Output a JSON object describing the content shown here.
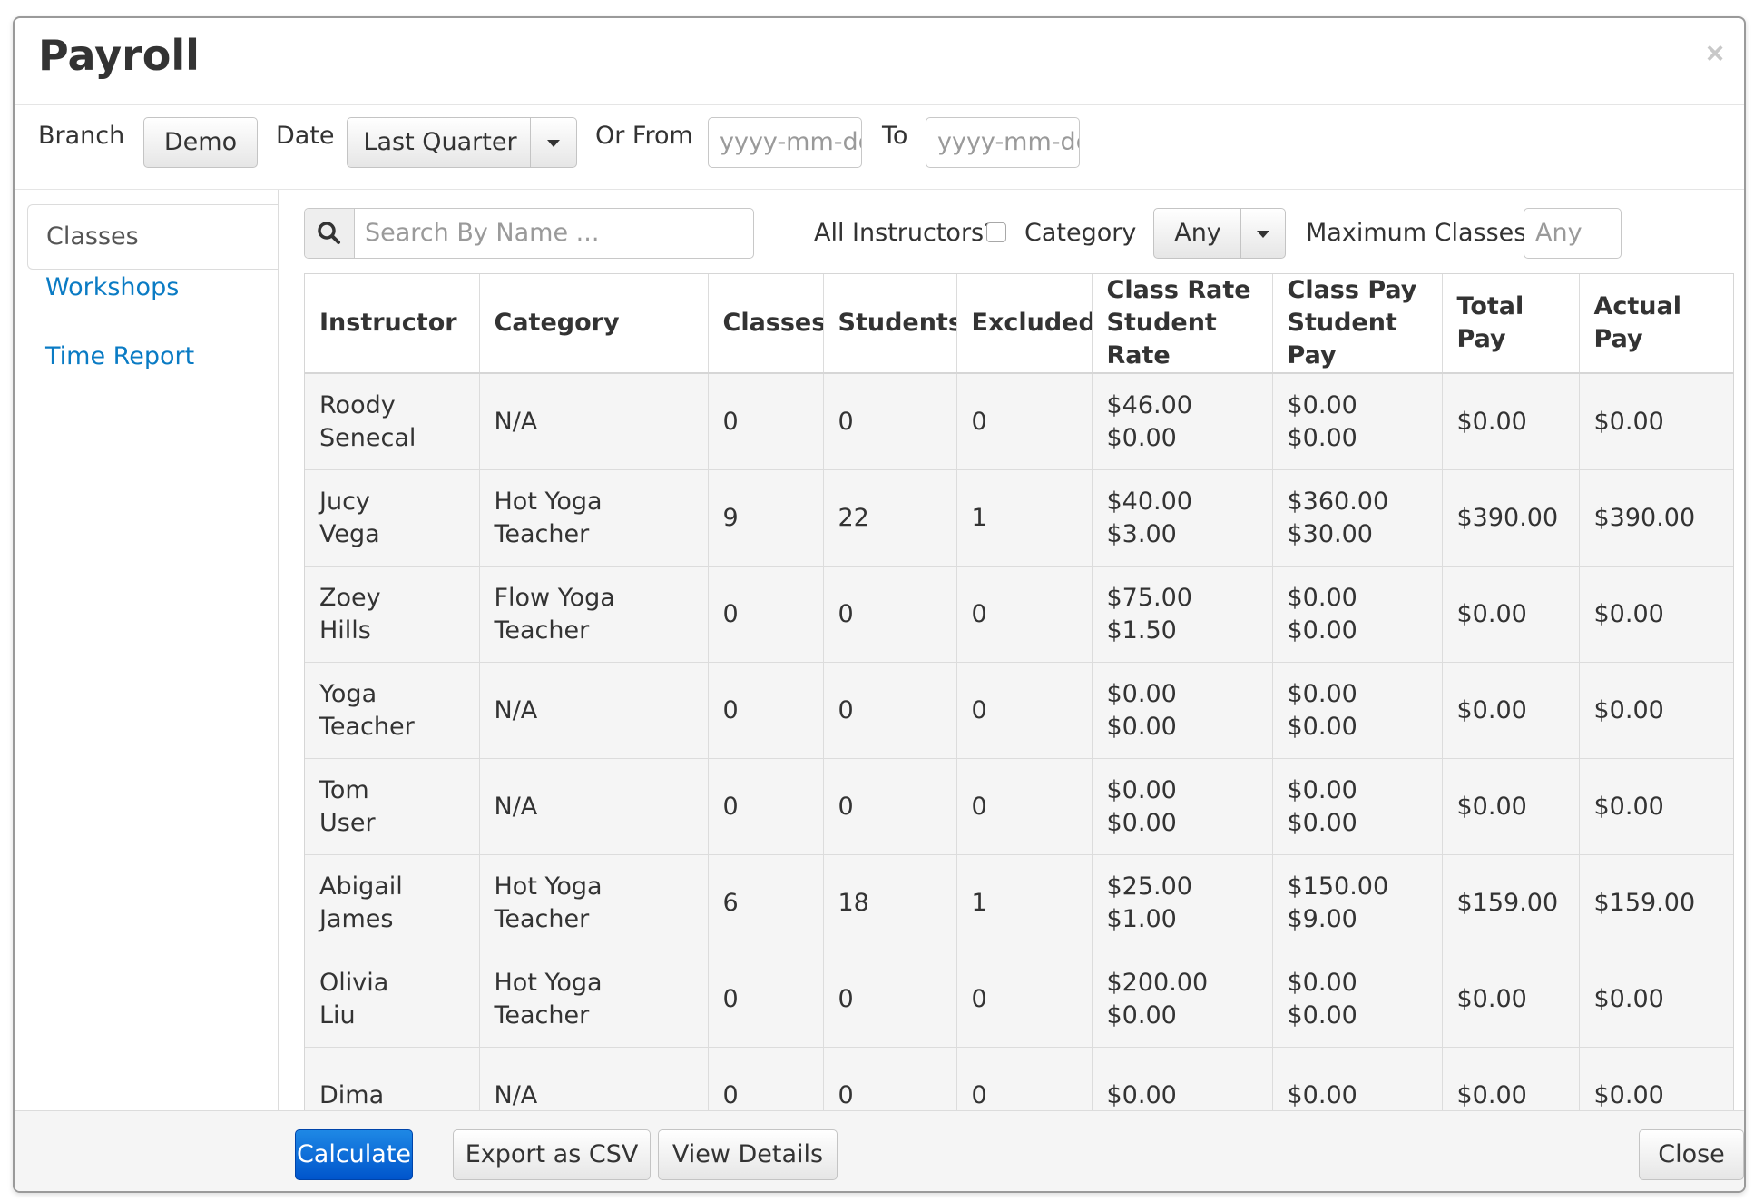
{
  "modal": {
    "title": "Payroll",
    "close_symbol": "×"
  },
  "filters": {
    "branch_label": "Branch",
    "branch_value": "Demo",
    "date_label": "Date",
    "date_value": "Last Quarter",
    "or_from_label": "Or From",
    "from_placeholder": "yyyy-mm-dd",
    "to_label": "To",
    "to_placeholder": "yyyy-mm-dd"
  },
  "sidebar": {
    "tabs": [
      {
        "label": "Classes",
        "active": true
      },
      {
        "label": "Workshops",
        "active": false
      },
      {
        "label": "Time Report",
        "active": false
      }
    ]
  },
  "toolbar": {
    "search_placeholder": "Search By Name ...",
    "search_icon": "search-icon",
    "all_instructors_label": "All Instructors?",
    "all_instructors_checked": false,
    "category_label": "Category",
    "category_value": "Any",
    "max_classes_label": "Maximum Classes",
    "max_classes_placeholder": "Any"
  },
  "table": {
    "headers": [
      {
        "line1": "Instructor",
        "line2": ""
      },
      {
        "line1": "Category",
        "line2": ""
      },
      {
        "line1": "Classes",
        "line2": ""
      },
      {
        "line1": "Students",
        "line2": ""
      },
      {
        "line1": "Excluded",
        "line2": ""
      },
      {
        "line1": "Class Rate",
        "line2": "Student Rate"
      },
      {
        "line1": "Class Pay",
        "line2": "Student Pay"
      },
      {
        "line1": "Total Pay",
        "line2": ""
      },
      {
        "line1": "Actual Pay",
        "line2": ""
      }
    ],
    "rows": [
      {
        "first": "Roody",
        "last": "Senecal",
        "category": "N/A",
        "classes": "0",
        "students": "0",
        "excluded": "0",
        "class_rate": "$46.00",
        "student_rate": "$0.00",
        "class_pay": "$0.00",
        "student_pay": "$0.00",
        "total_pay": "$0.00",
        "actual_pay": "$0.00"
      },
      {
        "first": "Jucy",
        "last": "Vega",
        "category": "Hot Yoga Teacher",
        "classes": "9",
        "students": "22",
        "excluded": "1",
        "class_rate": "$40.00",
        "student_rate": "$3.00",
        "class_pay": "$360.00",
        "student_pay": "$30.00",
        "total_pay": "$390.00",
        "actual_pay": "$390.00"
      },
      {
        "first": "Zoey",
        "last": "Hills",
        "category": "Flow Yoga Teacher",
        "classes": "0",
        "students": "0",
        "excluded": "0",
        "class_rate": "$75.00",
        "student_rate": "$1.50",
        "class_pay": "$0.00",
        "student_pay": "$0.00",
        "total_pay": "$0.00",
        "actual_pay": "$0.00"
      },
      {
        "first": "Yoga",
        "last": "Teacher",
        "category": "N/A",
        "classes": "0",
        "students": "0",
        "excluded": "0",
        "class_rate": "$0.00",
        "student_rate": "$0.00",
        "class_pay": "$0.00",
        "student_pay": "$0.00",
        "total_pay": "$0.00",
        "actual_pay": "$0.00"
      },
      {
        "first": "Tom",
        "last": "User",
        "category": "N/A",
        "classes": "0",
        "students": "0",
        "excluded": "0",
        "class_rate": "$0.00",
        "student_rate": "$0.00",
        "class_pay": "$0.00",
        "student_pay": "$0.00",
        "total_pay": "$0.00",
        "actual_pay": "$0.00"
      },
      {
        "first": "Abigail",
        "last": "James",
        "category": "Hot Yoga Teacher",
        "classes": "6",
        "students": "18",
        "excluded": "1",
        "class_rate": "$25.00",
        "student_rate": "$1.00",
        "class_pay": "$150.00",
        "student_pay": "$9.00",
        "total_pay": "$159.00",
        "actual_pay": "$159.00"
      },
      {
        "first": "Olivia",
        "last": "Liu",
        "category": "Hot Yoga Teacher",
        "classes": "0",
        "students": "0",
        "excluded": "0",
        "class_rate": "$200.00",
        "student_rate": "$0.00",
        "class_pay": "$0.00",
        "student_pay": "$0.00",
        "total_pay": "$0.00",
        "actual_pay": "$0.00"
      },
      {
        "first": "Dima",
        "last": "",
        "category": "N/A",
        "classes": "0",
        "students": "0",
        "excluded": "0",
        "class_rate": "$0.00",
        "student_rate": "",
        "class_pay": "$0.00",
        "student_pay": "",
        "total_pay": "$0.00",
        "actual_pay": "$0.00"
      }
    ]
  },
  "footer": {
    "calculate_label": "Calculate",
    "export_label": "Export as CSV",
    "details_label": "View Details",
    "close_label": "Close"
  },
  "colors": {
    "link": "#0a7bc4",
    "primary": "#0055cc",
    "row_background": "#f5f5f5"
  }
}
